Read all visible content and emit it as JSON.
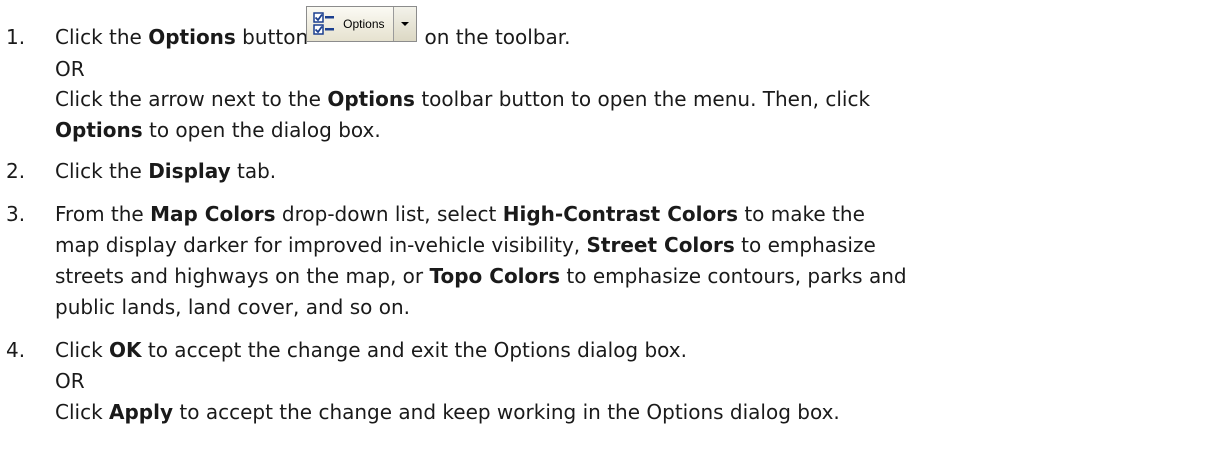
{
  "steps": [
    {
      "number": "1.",
      "line1": {
        "pre": "Click the ",
        "bold": "Options",
        "mid": " button ",
        "post": " on the toolbar."
      },
      "toolbar_button": {
        "label": "Options",
        "icon": "options-checklist-icon",
        "arrow_icon": "dropdown-arrow-icon"
      },
      "or1": "OR",
      "alt": {
        "pre": "Click the arrow next to the ",
        "bold1": "Options",
        "mid": " toolbar button to open the menu. Then, click",
        "bold2": "Options",
        "post": " to open the dialog box."
      }
    },
    {
      "number": "2.",
      "pre": "Click the ",
      "bold": "Display",
      "post": " tab."
    },
    {
      "number": "3.",
      "pre": "From the ",
      "bold1": "Map Colors",
      "mid1": " drop-down list, select ",
      "bold2": "High-Contrast Colors",
      "mid2": " to make the",
      "line2_pre": "map display darker for improved in-vehicle visibility, ",
      "bold3": "Street Colors",
      "mid3": " to emphasize",
      "line3_pre": "streets and highways on the map, or ",
      "bold4": "Topo Colors",
      "mid4": " to emphasize contours, parks and",
      "line4": "public lands, land cover, and so on."
    },
    {
      "number": "4.",
      "pre": "Click ",
      "bold": "OK",
      "post": " to accept the change and exit the Options dialog box.",
      "or": "OR",
      "alt_pre": "Click ",
      "alt_bold": "Apply",
      "alt_post": " to accept the change and keep working in the Options dialog box."
    }
  ]
}
